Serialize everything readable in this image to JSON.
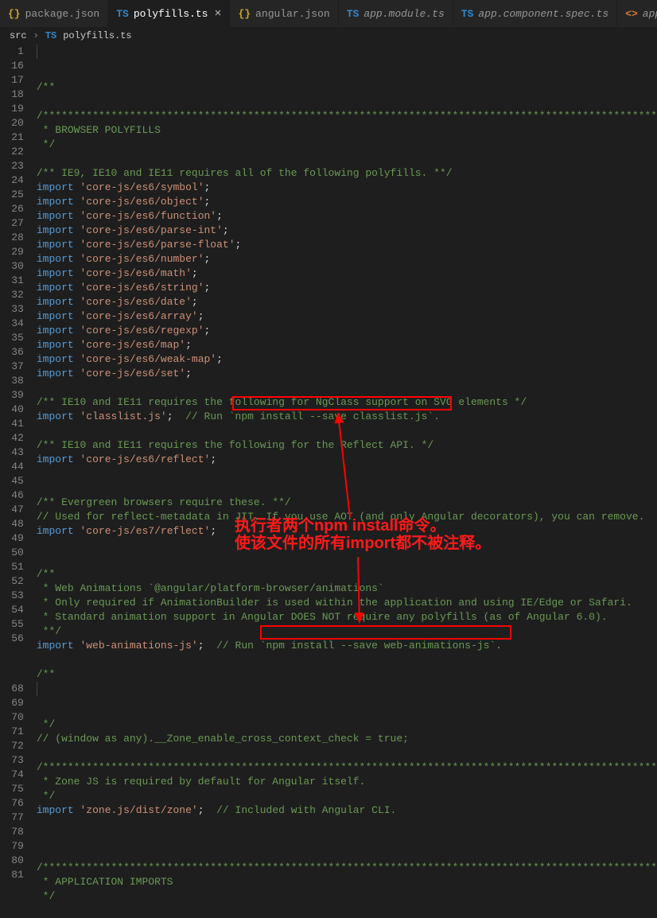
{
  "tabs": [
    {
      "badge": "{}",
      "label": "package.json",
      "badgeClass": "yellow",
      "cls": "norm"
    },
    {
      "badge": "TS",
      "label": "polyfills.ts",
      "badgeClass": "blue",
      "cls": "active",
      "close": "×"
    },
    {
      "badge": "{}",
      "label": "angular.json",
      "badgeClass": "yellow",
      "cls": "norm"
    },
    {
      "badge": "TS",
      "label": "app.module.ts",
      "badgeClass": "blue",
      "cls": ""
    },
    {
      "badge": "TS",
      "label": "app.component.spec.ts",
      "badgeClass": "blue",
      "cls": ""
    },
    {
      "badge": "<>",
      "label": "app.component.",
      "badgeClass": "orangeb",
      "cls": ""
    }
  ],
  "breadcrumb": {
    "p1": "src",
    "p2": "TS",
    "p3": "polyfills.ts"
  },
  "lines": {
    "1": [
      [
        "c-com",
        "/**"
      ]
    ],
    "16": [],
    "17": [
      [
        "c-com",
        "/***************************************************************************************************"
      ]
    ],
    "18": [
      [
        "c-com",
        " * BROWSER POLYFILLS"
      ]
    ],
    "19": [
      [
        "c-com",
        " */"
      ]
    ],
    "20": [],
    "21": [
      [
        "c-com",
        "/** IE9, IE10 and IE11 requires all of the following polyfills. **/"
      ]
    ],
    "22": [
      [
        "c-kw",
        "import"
      ],
      [
        "",
        " "
      ],
      [
        "c-str",
        "'core-js/es6/symbol'"
      ],
      [
        "",
        ";"
      ]
    ],
    "23": [
      [
        "c-kw",
        "import"
      ],
      [
        "",
        " "
      ],
      [
        "c-str",
        "'core-js/es6/object'"
      ],
      [
        "",
        ";"
      ]
    ],
    "24": [
      [
        "c-kw",
        "import"
      ],
      [
        "",
        " "
      ],
      [
        "c-str",
        "'core-js/es6/function'"
      ],
      [
        "",
        ";"
      ]
    ],
    "25": [
      [
        "c-kw",
        "import"
      ],
      [
        "",
        " "
      ],
      [
        "c-str",
        "'core-js/es6/parse-int'"
      ],
      [
        "",
        ";"
      ]
    ],
    "26": [
      [
        "c-kw",
        "import"
      ],
      [
        "",
        " "
      ],
      [
        "c-str",
        "'core-js/es6/parse-float'"
      ],
      [
        "",
        ";"
      ]
    ],
    "27": [
      [
        "c-kw",
        "import"
      ],
      [
        "",
        " "
      ],
      [
        "c-str",
        "'core-js/es6/number'"
      ],
      [
        "",
        ";"
      ]
    ],
    "28": [
      [
        "c-kw",
        "import"
      ],
      [
        "",
        " "
      ],
      [
        "c-str",
        "'core-js/es6/math'"
      ],
      [
        "",
        ";"
      ]
    ],
    "29": [
      [
        "c-kw",
        "import"
      ],
      [
        "",
        " "
      ],
      [
        "c-str",
        "'core-js/es6/string'"
      ],
      [
        "",
        ";"
      ]
    ],
    "30": [
      [
        "c-kw",
        "import"
      ],
      [
        "",
        " "
      ],
      [
        "c-str",
        "'core-js/es6/date'"
      ],
      [
        "",
        ";"
      ]
    ],
    "31": [
      [
        "c-kw",
        "import"
      ],
      [
        "",
        " "
      ],
      [
        "c-str",
        "'core-js/es6/array'"
      ],
      [
        "",
        ";"
      ]
    ],
    "32": [
      [
        "c-kw",
        "import"
      ],
      [
        "",
        " "
      ],
      [
        "c-str",
        "'core-js/es6/regexp'"
      ],
      [
        "",
        ";"
      ]
    ],
    "33": [
      [
        "c-kw",
        "import"
      ],
      [
        "",
        " "
      ],
      [
        "c-str",
        "'core-js/es6/map'"
      ],
      [
        "",
        ";"
      ]
    ],
    "34": [
      [
        "c-kw",
        "import"
      ],
      [
        "",
        " "
      ],
      [
        "c-str",
        "'core-js/es6/weak-map'"
      ],
      [
        "",
        ";"
      ]
    ],
    "35": [
      [
        "c-kw",
        "import"
      ],
      [
        "",
        " "
      ],
      [
        "c-str",
        "'core-js/es6/set'"
      ],
      [
        "",
        ";"
      ]
    ],
    "36": [],
    "37": [
      [
        "c-com",
        "/** IE10 and IE11 requires the following for NgClass support on SVG elements */"
      ]
    ],
    "38": [
      [
        "c-kw",
        "import"
      ],
      [
        "",
        " "
      ],
      [
        "c-str",
        "'classlist.js'"
      ],
      [
        "",
        ";  "
      ],
      [
        "c-com",
        "// Run `npm install --save classlist.js`."
      ]
    ],
    "39": [],
    "40": [
      [
        "c-com",
        "/** IE10 and IE11 requires the following for the Reflect API. */"
      ]
    ],
    "41": [
      [
        "c-kw",
        "import"
      ],
      [
        "",
        " "
      ],
      [
        "c-str",
        "'core-js/es6/reflect'"
      ],
      [
        "",
        ";"
      ]
    ],
    "42": [],
    "43": [],
    "44": [
      [
        "c-com",
        "/** Evergreen browsers require these. **/"
      ]
    ],
    "45": [
      [
        "c-com",
        "// Used for reflect-metadata in JIT. If you use AOT (and only Angular decorators), you can remove."
      ]
    ],
    "46": [
      [
        "c-kw",
        "import"
      ],
      [
        "",
        " "
      ],
      [
        "c-str",
        "'core-js/es7/reflect'"
      ],
      [
        "",
        ";"
      ]
    ],
    "47": [],
    "48": [],
    "49": [
      [
        "c-com",
        "/**"
      ]
    ],
    "50": [
      [
        "c-com",
        " * Web Animations `@angular/platform-browser/animations`"
      ]
    ],
    "51": [
      [
        "c-com",
        " * Only required if AnimationBuilder is used within the application and using IE/Edge or Safari."
      ]
    ],
    "52": [
      [
        "c-com",
        " * Standard animation support in Angular DOES NOT require any polyfills (as of Angular 6.0)."
      ]
    ],
    "53": [
      [
        "c-com",
        " **/"
      ]
    ],
    "54": [
      [
        "c-kw",
        "import"
      ],
      [
        "",
        " "
      ],
      [
        "c-str",
        "'web-animations-js'"
      ],
      [
        "",
        ";  "
      ],
      [
        "c-com",
        "// Run `npm install --save web-animations-js`."
      ]
    ],
    "55": [],
    "56": [
      [
        "c-com",
        "/**"
      ]
    ]
  },
  "lines2": {
    "68": [
      [
        "c-com",
        " */"
      ]
    ],
    "69": [
      [
        "c-com",
        "// (window as any).__Zone_enable_cross_context_check = true;"
      ]
    ],
    "70": [],
    "71": [
      [
        "c-com",
        "/***************************************************************************************************"
      ]
    ],
    "72": [
      [
        "c-com",
        " * Zone JS is required by default for Angular itself."
      ]
    ],
    "73": [
      [
        "c-com",
        " */"
      ]
    ],
    "74": [
      [
        "c-kw",
        "import"
      ],
      [
        "",
        " "
      ],
      [
        "c-str",
        "'zone.js/dist/zone'"
      ],
      [
        "",
        ";  "
      ],
      [
        "c-com",
        "// Included with Angular CLI."
      ]
    ],
    "75": [],
    "76": [],
    "77": [],
    "78": [
      [
        "c-com",
        "/***************************************************************************************************"
      ]
    ],
    "79": [
      [
        "c-com",
        " * APPLICATION IMPORTS"
      ]
    ],
    "80": [
      [
        "c-com",
        " */"
      ]
    ],
    "81": []
  },
  "lineOrder": [
    "1",
    "16",
    "17",
    "18",
    "19",
    "20",
    "21",
    "22",
    "23",
    "24",
    "25",
    "26",
    "27",
    "28",
    "29",
    "30",
    "31",
    "32",
    "33",
    "34",
    "35",
    "36",
    "37",
    "38",
    "39",
    "40",
    "41",
    "42",
    "43",
    "44",
    "45",
    "46",
    "47",
    "48",
    "49",
    "50",
    "51",
    "52",
    "53",
    "54",
    "55",
    "56"
  ],
  "lineOrder2": [
    "68",
    "69",
    "70",
    "71",
    "72",
    "73",
    "74",
    "75",
    "76",
    "77",
    "78",
    "79",
    "80",
    "81"
  ],
  "annotation": {
    "line1": "执行者两个npm install命令。",
    "line2": "使该文件的所有import都不被注释。"
  }
}
